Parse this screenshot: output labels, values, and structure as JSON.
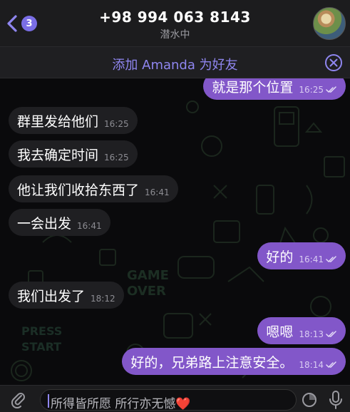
{
  "header": {
    "back_badge": "3",
    "title": "+98 994 063 8143",
    "subtitle": "潜水中"
  },
  "add_friend_bar": {
    "label": "添加 Amanda 为好友"
  },
  "messages": [
    {
      "text": "就是那个位置",
      "time": "16:25",
      "direction": "out",
      "read": true
    },
    {
      "text": "群里发给他们",
      "time": "16:25",
      "direction": "in"
    },
    {
      "text": "我去确定时间",
      "time": "16:25",
      "direction": "in"
    },
    {
      "text": "他让我们收拾东西了",
      "time": "16:41",
      "direction": "in"
    },
    {
      "text": "一会出发",
      "time": "16:41",
      "direction": "in"
    },
    {
      "text": "好的",
      "time": "16:41",
      "direction": "out",
      "read": true
    },
    {
      "text": "我们出发了",
      "time": "18:12",
      "direction": "in"
    },
    {
      "text": "嗯嗯",
      "time": "18:13",
      "direction": "out",
      "read": true
    },
    {
      "text": "好的，兄弟路上注意安全。",
      "time": "18:14",
      "direction": "out",
      "read": true
    }
  ],
  "composer": {
    "draft": "所得皆所愿 所行亦无憾❤️"
  },
  "colors": {
    "accent": "#8f86f0",
    "outgoing_bubble": "#8257c9",
    "incoming_bubble": "#1f1f22",
    "background": "#0a0a0c"
  },
  "icons": [
    "chevron-left-icon",
    "close-circle-icon",
    "paperclip-icon",
    "sticker-icon",
    "microphone-icon",
    "double-check-icon"
  ]
}
